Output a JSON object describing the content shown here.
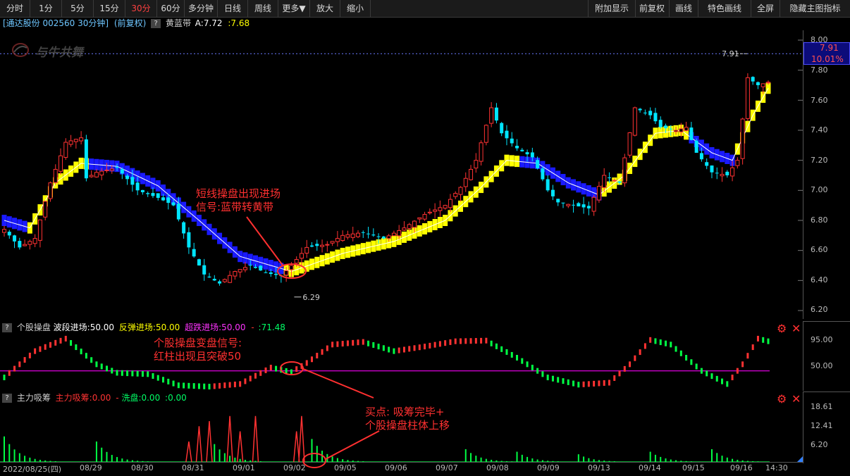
{
  "toolbar": {
    "left": [
      "分时",
      "1分",
      "5分",
      "15分",
      "30分",
      "60分",
      "多分钟",
      "日线",
      "周线",
      "更多▼",
      "放大",
      "缩小"
    ],
    "active": "30分",
    "right": [
      "附加显示",
      "前复权",
      "画线",
      "特色画线",
      "全屏",
      "隐藏主图指标"
    ]
  },
  "info": {
    "stock": "[通达股份 002560 30分钟]",
    "adj": "(前复权)",
    "q": "?",
    "ind": "黄蓝带",
    "a_label": "A:7.72",
    "a_value": ":7.68",
    "watermark": "与牛共舞"
  },
  "price_axis": {
    "ticks": [
      "8.00",
      "7.80",
      "7.60",
      "7.40",
      "7.20",
      "7.00",
      "6.80",
      "6.60",
      "6.40",
      "6.20"
    ],
    "tick_values": [
      8.0,
      7.8,
      7.6,
      7.4,
      7.2,
      7.0,
      6.8,
      6.6,
      6.4,
      6.2
    ],
    "current_price": "7.91",
    "change_pct": "10.01%",
    "high_mark": "7.91",
    "low_mark": "6.29"
  },
  "panel2": {
    "q": "?",
    "name": "个股操盘",
    "wave": "波段进场:50.00",
    "rebound": "反弹进场:50.00",
    "oversold": "超跌进场:50.00",
    "dash": "-",
    "value": ":71.48",
    "ticks": [
      "95.00",
      "50.00"
    ]
  },
  "panel3": {
    "q": "?",
    "name": "主力吸筹",
    "absorb": "主力吸筹:0.00",
    "dash": "-",
    "wash": "洗盘:0.00",
    "value": ":0.00",
    "ticks": [
      "18.61",
      "12.41",
      "6.20"
    ]
  },
  "annotations": {
    "a1_line1": "短线操盘出现进场",
    "a1_line2": "信号:蓝带转黄带",
    "a2_line1": "个股操盘变盘信号:",
    "a2_line2": "红柱出现且突破50",
    "a3_line1": "买点: 吸筹完毕+",
    "a3_line2": "个股操盘柱体上移"
  },
  "dates": [
    "2022/08/25(四)",
    "08/29",
    "08/30",
    "08/31",
    "09/01",
    "09/02",
    "09/05",
    "09/06",
    "09/07",
    "09/08",
    "09/09",
    "09/13",
    "09/14",
    "09/15",
    "09/16",
    "14:30"
  ],
  "colors": {
    "up": "#ff3232",
    "down": "#00e5ff",
    "yellow": "#ffff00",
    "blue": "#1a1aff",
    "accent": "#ff3030"
  },
  "chart_data": {
    "type": "candlestick",
    "price_range": [
      6.2,
      8.0
    ],
    "price_anchors": [
      {
        "bar": 0,
        "close": 6.74
      },
      {
        "bar": 3,
        "close": 6.62
      },
      {
        "bar": 6,
        "close": 6.68
      },
      {
        "bar": 9,
        "close": 7.05
      },
      {
        "bar": 12,
        "close": 7.32
      },
      {
        "bar": 15,
        "close": 7.35
      },
      {
        "bar": 16,
        "close": 7.08
      },
      {
        "bar": 18,
        "close": 7.12
      },
      {
        "bar": 22,
        "close": 7.15
      },
      {
        "bar": 26,
        "close": 7.0
      },
      {
        "bar": 30,
        "close": 6.95
      },
      {
        "bar": 33,
        "close": 6.9
      },
      {
        "bar": 36,
        "close": 6.62
      },
      {
        "bar": 39,
        "close": 6.44
      },
      {
        "bar": 42,
        "close": 6.38
      },
      {
        "bar": 45,
        "close": 6.46
      },
      {
        "bar": 48,
        "close": 6.5
      },
      {
        "bar": 51,
        "close": 6.45
      },
      {
        "bar": 54,
        "close": 6.43
      },
      {
        "bar": 56,
        "close": 6.5
      },
      {
        "bar": 59,
        "close": 6.62
      },
      {
        "bar": 63,
        "close": 6.64
      },
      {
        "bar": 66,
        "close": 6.7
      },
      {
        "bar": 70,
        "close": 6.72
      },
      {
        "bar": 74,
        "close": 6.68
      },
      {
        "bar": 78,
        "close": 6.75
      },
      {
        "bar": 82,
        "close": 6.84
      },
      {
        "bar": 86,
        "close": 6.9
      },
      {
        "bar": 89,
        "close": 7.02
      },
      {
        "bar": 92,
        "close": 7.2
      },
      {
        "bar": 95,
        "close": 7.55
      },
      {
        "bar": 97,
        "close": 7.38
      },
      {
        "bar": 100,
        "close": 7.28
      },
      {
        "bar": 103,
        "close": 7.22
      },
      {
        "bar": 106,
        "close": 7.0
      },
      {
        "bar": 108,
        "close": 6.92
      },
      {
        "bar": 111,
        "close": 6.9
      },
      {
        "bar": 114,
        "close": 6.88
      },
      {
        "bar": 117,
        "close": 7.1
      },
      {
        "bar": 120,
        "close": 7.05
      },
      {
        "bar": 123,
        "close": 7.55
      },
      {
        "bar": 126,
        "close": 7.5
      },
      {
        "bar": 128,
        "close": 7.42
      },
      {
        "bar": 131,
        "close": 7.4
      },
      {
        "bar": 133,
        "close": 7.42
      },
      {
        "bar": 135,
        "close": 7.25
      },
      {
        "bar": 138,
        "close": 7.12
      },
      {
        "bar": 141,
        "close": 7.1
      },
      {
        "bar": 143,
        "close": 7.2
      },
      {
        "bar": 145,
        "close": 7.75
      },
      {
        "bar": 147,
        "close": 7.7
      },
      {
        "bar": 149,
        "close": 7.72
      }
    ],
    "band_anchors": [
      {
        "bar": 0,
        "value": 6.8
      },
      {
        "bar": 5,
        "value": 6.75
      },
      {
        "bar": 10,
        "value": 7.05
      },
      {
        "bar": 15,
        "value": 7.18
      },
      {
        "bar": 22,
        "value": 7.16
      },
      {
        "bar": 30,
        "value": 7.03
      },
      {
        "bar": 38,
        "value": 6.8
      },
      {
        "bar": 46,
        "value": 6.56
      },
      {
        "bar": 56,
        "value": 6.46
      },
      {
        "bar": 66,
        "value": 6.58
      },
      {
        "bar": 76,
        "value": 6.66
      },
      {
        "bar": 86,
        "value": 6.8
      },
      {
        "bar": 93,
        "value": 7.02
      },
      {
        "bar": 98,
        "value": 7.2
      },
      {
        "bar": 104,
        "value": 7.18
      },
      {
        "bar": 110,
        "value": 7.05
      },
      {
        "bar": 116,
        "value": 6.97
      },
      {
        "bar": 121,
        "value": 7.1
      },
      {
        "bar": 127,
        "value": 7.38
      },
      {
        "bar": 132,
        "value": 7.4
      },
      {
        "bar": 138,
        "value": 7.25
      },
      {
        "bar": 142,
        "value": 7.2
      },
      {
        "bar": 146,
        "value": 7.5
      },
      {
        "bar": 149,
        "value": 7.68
      }
    ],
    "blue_segments": [
      [
        0,
        4
      ],
      [
        17,
        54
      ],
      [
        101,
        116
      ],
      [
        134,
        142
      ]
    ],
    "panel2_osc_anchors": [
      {
        "bar": 0,
        "value": 40
      },
      {
        "bar": 6,
        "value": 80
      },
      {
        "bar": 12,
        "value": 99
      },
      {
        "bar": 18,
        "value": 60
      },
      {
        "bar": 22,
        "value": 47
      },
      {
        "bar": 28,
        "value": 45
      },
      {
        "bar": 34,
        "value": 28
      },
      {
        "bar": 40,
        "value": 26
      },
      {
        "bar": 46,
        "value": 30
      },
      {
        "bar": 52,
        "value": 55
      },
      {
        "bar": 56,
        "value": 48
      },
      {
        "bar": 59,
        "value": 62
      },
      {
        "bar": 64,
        "value": 90
      },
      {
        "bar": 70,
        "value": 94
      },
      {
        "bar": 76,
        "value": 80
      },
      {
        "bar": 82,
        "value": 87
      },
      {
        "bar": 88,
        "value": 95
      },
      {
        "bar": 94,
        "value": 96
      },
      {
        "bar": 100,
        "value": 70
      },
      {
        "bar": 106,
        "value": 40
      },
      {
        "bar": 112,
        "value": 29
      },
      {
        "bar": 118,
        "value": 32
      },
      {
        "bar": 122,
        "value": 60
      },
      {
        "bar": 126,
        "value": 97
      },
      {
        "bar": 130,
        "value": 90
      },
      {
        "bar": 136,
        "value": 50
      },
      {
        "bar": 141,
        "value": 30
      },
      {
        "bar": 144,
        "value": 60
      },
      {
        "bar": 147,
        "value": 99
      },
      {
        "bar": 149,
        "value": 95
      }
    ],
    "panel2_range": [
      25,
      100
    ],
    "panel2_midline": 50,
    "panel3_range": [
      0,
      21
    ],
    "panel3_red_spikes": [
      {
        "bar": 36,
        "value": 8
      },
      {
        "bar": 38,
        "value": 14
      },
      {
        "bar": 40,
        "value": 16
      },
      {
        "bar": 44,
        "value": 18
      },
      {
        "bar": 46,
        "value": 12
      },
      {
        "bar": 49,
        "value": 18
      },
      {
        "bar": 57,
        "value": 12
      },
      {
        "bar": 58,
        "value": 18
      }
    ],
    "panel3_green_peaks": [
      {
        "bar": 0,
        "value": 10
      },
      {
        "bar": 18,
        "value": 8
      },
      {
        "bar": 41,
        "value": 7
      },
      {
        "bar": 60,
        "value": 9
      },
      {
        "bar": 90,
        "value": 5
      },
      {
        "bar": 100,
        "value": 4
      },
      {
        "bar": 112,
        "value": 3
      },
      {
        "bar": 126,
        "value": 4
      },
      {
        "bar": 138,
        "value": 5
      }
    ]
  }
}
